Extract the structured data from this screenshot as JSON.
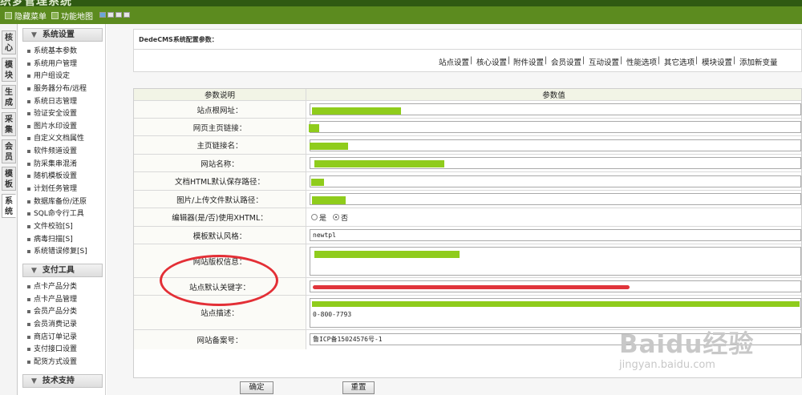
{
  "app": {
    "title": "织梦管理系统"
  },
  "toolbar": {
    "hide_menu": "隐藏菜单",
    "func_map": "功能地图"
  },
  "vtabs": [
    "核心",
    "模块",
    "生成",
    "采集",
    "会员",
    "模板",
    "系统"
  ],
  "sidebar": {
    "sections": [
      {
        "title": "系统设置",
        "items": [
          "系统基本参数",
          "系统用户管理",
          "用户组设定",
          "服务器分布/远程",
          "系统日志管理",
          "验证安全设置",
          "图片水印设置",
          "自定义文档属性",
          "软件频道设置",
          "防采集串混淆",
          "随机模板设置",
          "计划任务管理",
          "数据库备份/还原",
          "SQL命令行工具",
          "文件校验[S]",
          "病毒扫描[S]",
          "系统错误修复[S]"
        ]
      },
      {
        "title": "支付工具",
        "items": [
          "点卡产品分类",
          "点卡产品管理",
          "会员产品分类",
          "会员消费记录",
          "商店订单记录",
          "支付接口设置",
          "配货方式设置"
        ]
      },
      {
        "title": "技术支持",
        "items": []
      }
    ]
  },
  "header": {
    "title": "DedeCMS系统配置参数：",
    "tabs": [
      "站点设置",
      "核心设置",
      "附件设置",
      "会员设置",
      "互动设置",
      "性能选项",
      "其它选项",
      "模块设置",
      "添加新变量"
    ]
  },
  "table": {
    "head": {
      "label": "参数说明",
      "value": "参数值"
    },
    "rows": [
      {
        "label": "站点根网址：",
        "value": ""
      },
      {
        "label": "网页主页链接：",
        "value": ""
      },
      {
        "label": "主页链接名：",
        "value": ""
      },
      {
        "label": "网站名称：",
        "value": ""
      },
      {
        "label": "文档HTML默认保存路径：",
        "value": ""
      },
      {
        "label": "图片/上传文件默认路径：",
        "value": ""
      },
      {
        "label": "编辑器(是/否)使用XHTML：",
        "options": [
          "是",
          "否"
        ],
        "selected": "否"
      },
      {
        "label": "模板默认风格：",
        "value": "newtpl"
      },
      {
        "label": "网站版权信息：",
        "value": ""
      },
      {
        "label": "站点默认关键字：",
        "value": ""
      },
      {
        "label": "站点描述：",
        "value": "0-800-7793"
      },
      {
        "label": "网站备案号：",
        "value": "鲁ICP备15024576号-1"
      }
    ]
  },
  "buttons": {
    "ok": "确定",
    "reset": "重置"
  },
  "watermark": {
    "logo": "Baidu经验",
    "url": "jingyan.baidu.com"
  },
  "colors": {
    "highlight": "#8fcc1c",
    "annotation": "#e32f36",
    "toolbar": "#5c8b1f"
  }
}
